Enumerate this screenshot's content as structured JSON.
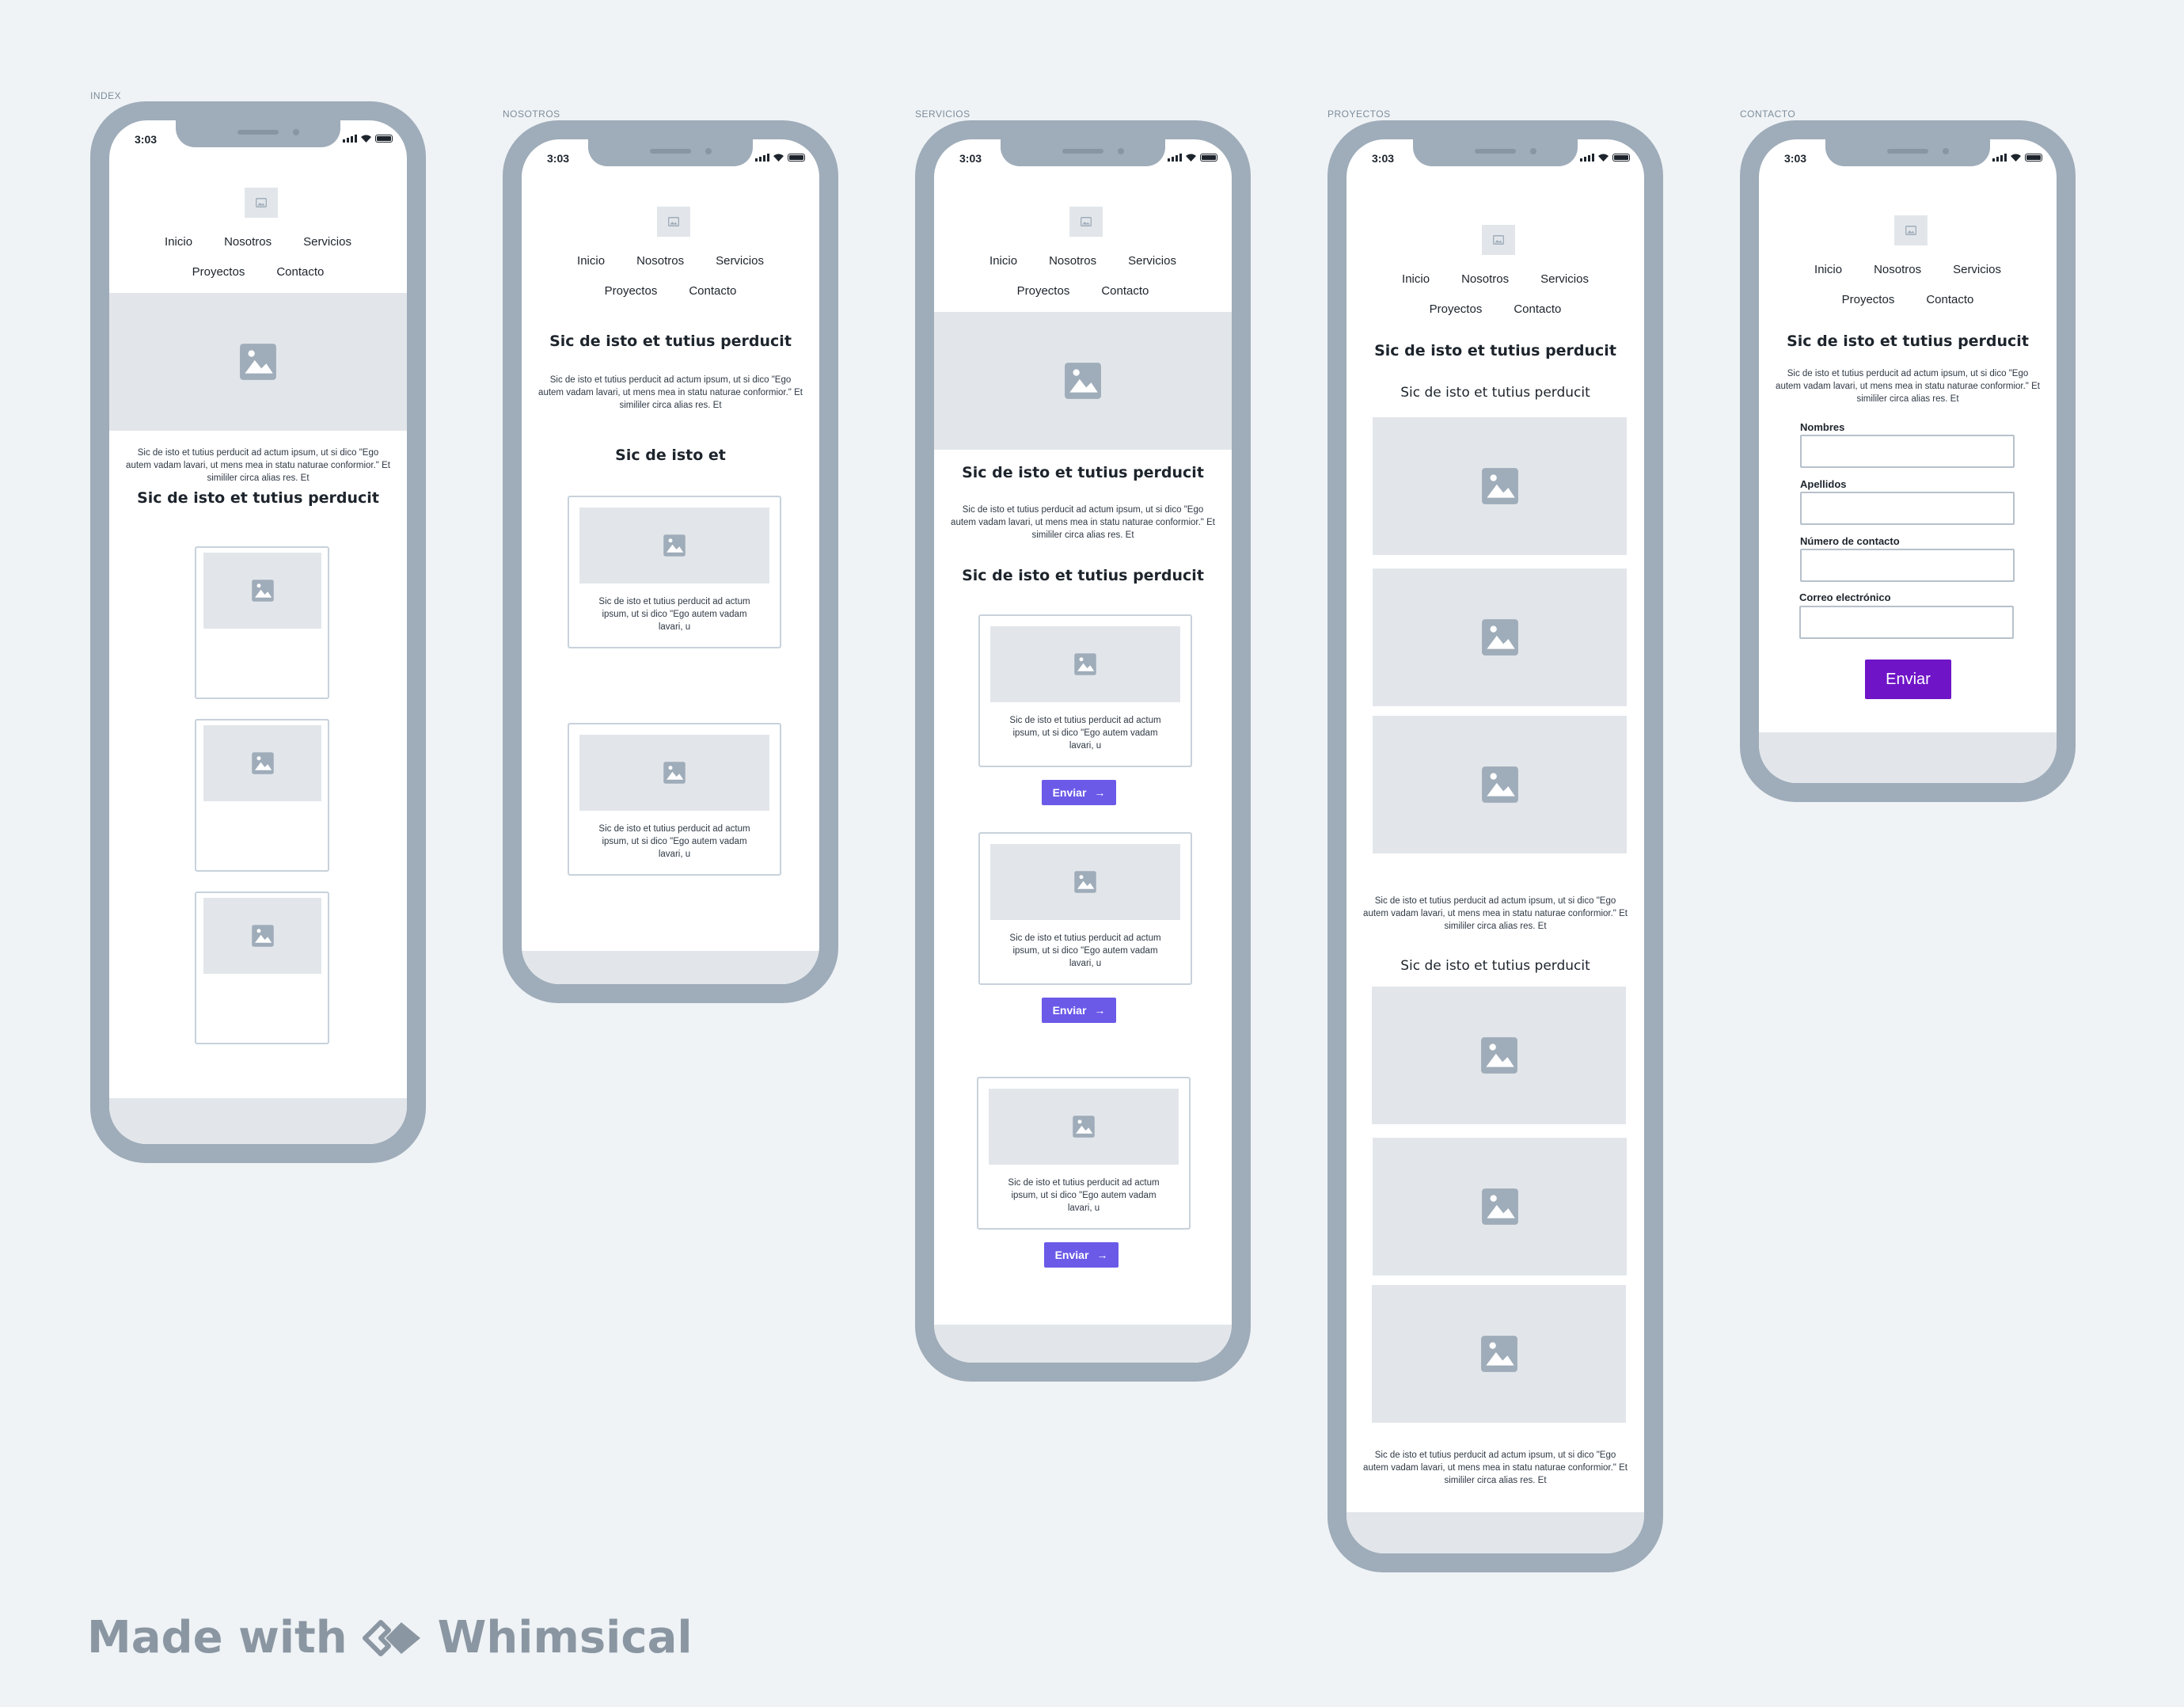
{
  "screens": {
    "index": {
      "label": "INDEX"
    },
    "nosotros": {
      "label": "NOSOTROS"
    },
    "servicios": {
      "label": "SERVICIOS"
    },
    "proyectos": {
      "label": "PROYECTOS"
    },
    "contacto": {
      "label": "CONTACTO"
    }
  },
  "status": {
    "time": "3:03"
  },
  "nav": {
    "inicio": "Inicio",
    "nosotros": "Nosotros",
    "servicios": "Servicios",
    "proyectos": "Proyectos",
    "contacto": "Contacto"
  },
  "content": {
    "heading": "Sic de isto et tutius perducit",
    "heading_short": "Sic de isto et",
    "paragraph": "Sic de isto et tutius perducit ad actum ipsum, ut si dico \"Ego autem vadam lavari, ut mens mea in statu naturae conformior.\" Et simililer circa alias res. Et",
    "card_text": "Sic de isto et tutius perducit ad actum ipsum, ut si dico \"Ego autem vadam lavari, u"
  },
  "buttons": {
    "enviar": "Enviar"
  },
  "form": {
    "nombres": "Nombres",
    "apellidos": "Apellidos",
    "numero": "Número de contacto",
    "correo": "Correo electrónico",
    "submit": "Enviar"
  },
  "branding": {
    "made_with": "Made with",
    "brand": "Whimsical"
  },
  "icons": {
    "image": "image-icon",
    "arrow": "arrow-right-icon",
    "logo": "whimsical-logo-icon"
  }
}
